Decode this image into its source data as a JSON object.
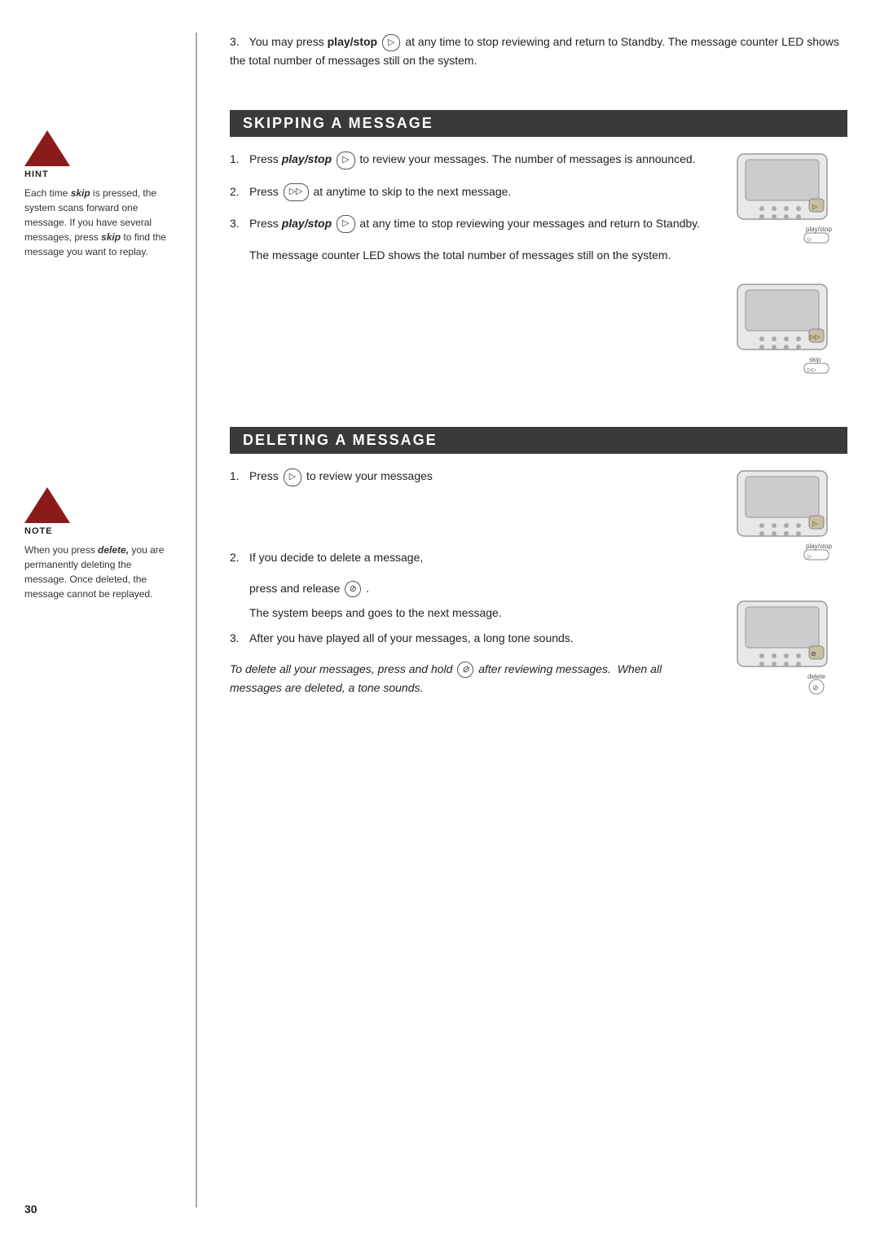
{
  "page": {
    "number": "30",
    "intro": {
      "num": "3.",
      "text_before_bold": "You may press ",
      "bold": "play/stop",
      "text_after": " at any time to stop reviewing and return to Standby. The message counter LED shows the total number of messages still on the system."
    },
    "hint": {
      "label": "HINT",
      "text_before_bold": "Each time ",
      "bold": "skip",
      "text_after": " is pressed, the system scans forward one message. If you have several messages, press ",
      "bold2": "skip",
      "text_after2": " to find the message you want to replay."
    },
    "note": {
      "label": "NOTE",
      "text_before_bold": "When you press ",
      "bold": "delete,",
      "text_after": " you are permanently deleting the message. Once deleted, the message cannot be replayed."
    },
    "section1": {
      "title": "SKIPPING A MESSAGE",
      "steps": [
        {
          "num": "1.",
          "text_before_bold": "Press ",
          "bold": "play/stop",
          "text_after": " to review your messages. The number of messages is announced."
        },
        {
          "num": "2.",
          "text_before": "Press ",
          "icon": "▷▷",
          "text_after": " at anytime to skip to the next message."
        },
        {
          "num": "3.",
          "text_before_bold": "Press ",
          "bold": "play/stop",
          "text_after": " at any time to stop reviewing your messages and return to Standby."
        }
      ],
      "step3_extra": "The message counter LED shows the total number of messages still on the system."
    },
    "section2": {
      "title": "DELETING A MESSAGE",
      "steps": [
        {
          "num": "1.",
          "text_before": "Press ",
          "icon": "▷",
          "text_after": " to review your messages"
        },
        {
          "num": "2.",
          "text": "If you decide to delete a message,",
          "substep1_before": "press and release ",
          "substep1_icon": "⊘",
          "substep1_after": ".",
          "substep2": "The system beeps and goes to the next message."
        },
        {
          "num": "3.",
          "text": "After you have played all of your messages, a long tone sounds."
        }
      ],
      "note_italic": "To delete all your messages, press and hold",
      "note_icon": "⊘",
      "note_italic2": " after reviewing messages.  When all messages are deleted, a tone sounds."
    }
  }
}
